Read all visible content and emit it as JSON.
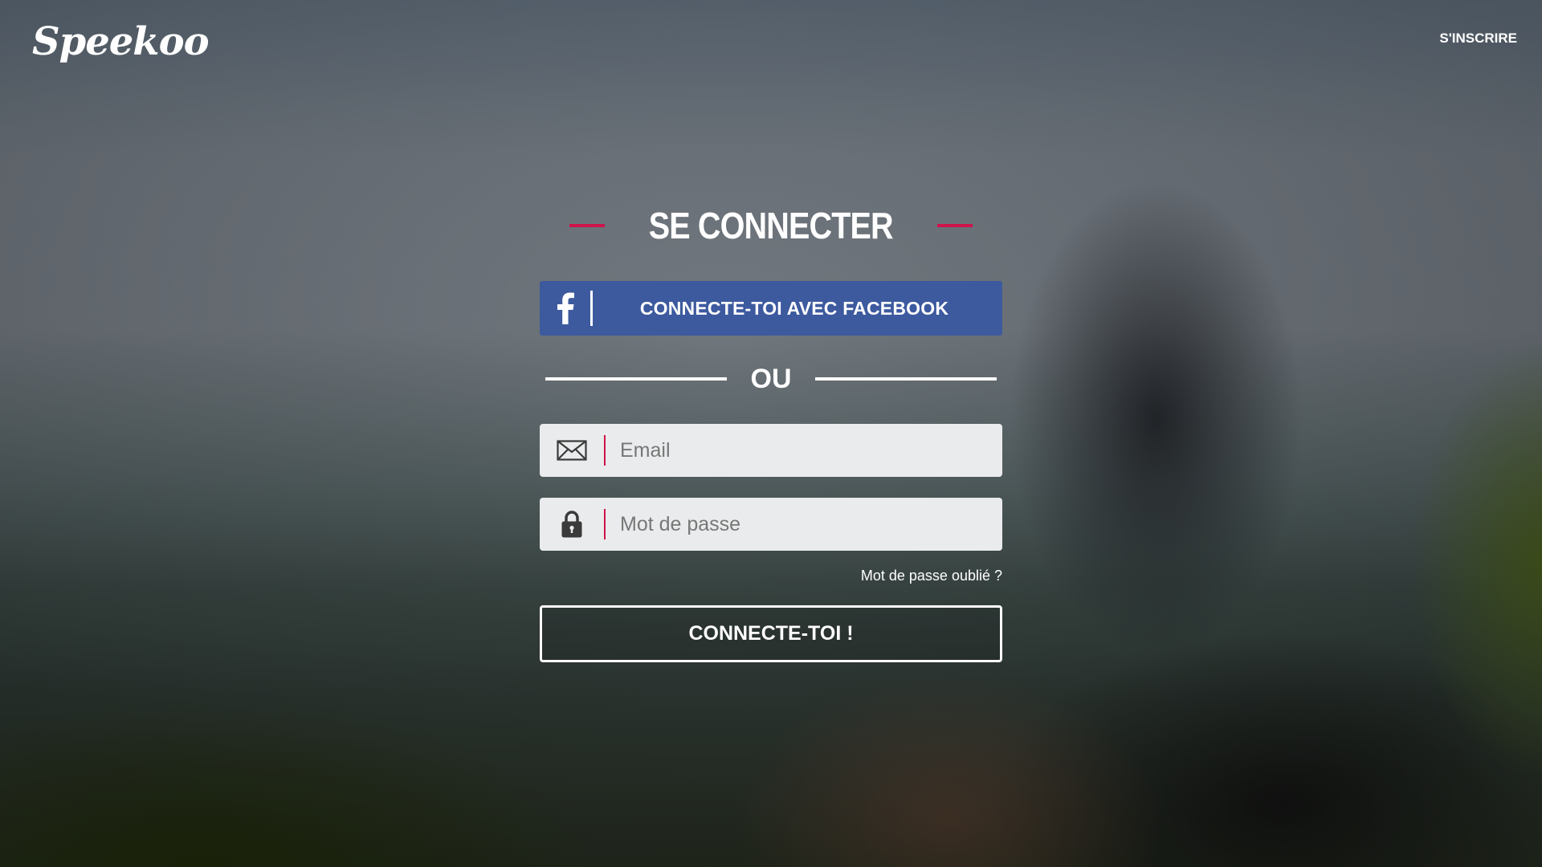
{
  "header": {
    "logo_text": "Speekoo",
    "signup_label": "S'INSCRIRE"
  },
  "login": {
    "title": "SE CONNECTER",
    "facebook_button_label": "CONNECTE-TOI AVEC FACEBOOK",
    "separator_label": "OU",
    "email_placeholder": "Email",
    "password_placeholder": "Mot de passe",
    "forgot_password_label": "Mot de passe oublié ?",
    "submit_label": "CONNECTE-TOI !"
  },
  "icons": {
    "facebook": "facebook-icon",
    "email": "envelope-icon",
    "password": "lock-icon"
  },
  "colors": {
    "accent": "#d0134a",
    "facebook_blue": "#3d5a9f",
    "field_background": "#eaebec",
    "text": "#ffffff"
  }
}
